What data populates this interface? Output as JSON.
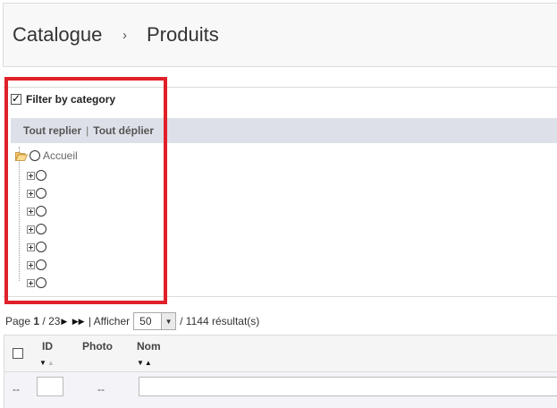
{
  "breadcrumb": {
    "item1": "Catalogue",
    "separator": "›",
    "item2": "Produits"
  },
  "filter": {
    "checkbox_label": "Filter by category",
    "checked": true,
    "collapse_all": "Tout replier",
    "divider": "|",
    "expand_all": "Tout déplier",
    "root_label": "Accueil",
    "child_count": 7
  },
  "pagination": {
    "page_prefix": "Page",
    "current_page": "1",
    "total_pages": "/ 23",
    "show_label": "| Afficher",
    "per_page": "50",
    "results": "/ 1144 résultat(s)"
  },
  "table": {
    "headers": {
      "id": "ID",
      "photo": "Photo",
      "name": "Nom"
    },
    "filter_row": {
      "select_placeholder": "--",
      "photo_placeholder": "--"
    }
  },
  "colors": {
    "highlight": "#e0202a",
    "tree_bar": "#dde0e8"
  }
}
